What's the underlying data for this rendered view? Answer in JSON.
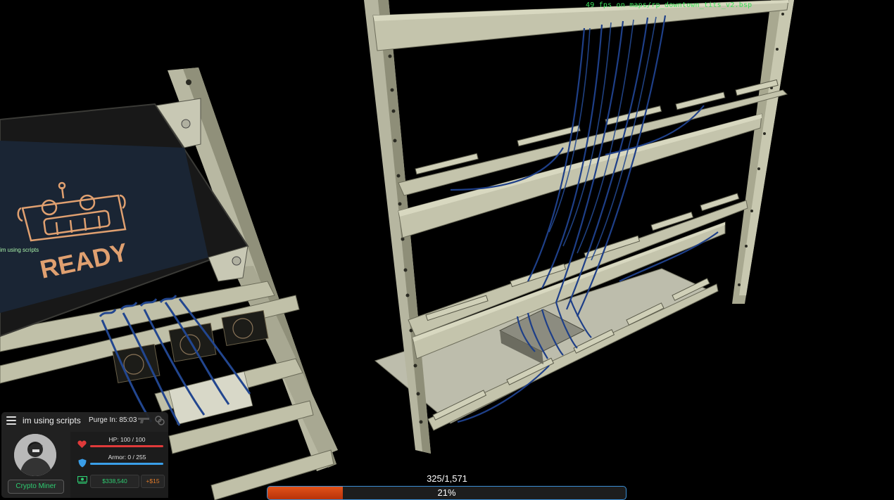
{
  "world": {
    "fps_text": "49 fps on maps/rp_downtown_tits_v2.bsp",
    "screen_text": "READY",
    "overhead_name": "im using scripts"
  },
  "hud": {
    "player_name": "im using scripts",
    "purge_text": "Purge  In: 85:03",
    "job": "Crypto Miner",
    "hp_label": "HP: 100 / 100",
    "hp_fraction": 1.0,
    "armor_label": "Armor: 0 / 255",
    "armor_fraction": 0.0,
    "money": "$338,540",
    "salary": "+$15",
    "icons": [
      "menu-icon",
      "gun-icon",
      "lock-icon",
      "heart-icon",
      "shield-icon",
      "money-icon"
    ],
    "colors": {
      "hp": "#e03a3a",
      "armor": "#3a9ee8",
      "money": "#2ecc71",
      "salary": "#e07a2a"
    }
  },
  "progress": {
    "count": "325/1,571",
    "percent_label": "21%",
    "fraction": 0.21,
    "fill_color": "#e2521a",
    "border_color": "#3b8fd6"
  }
}
